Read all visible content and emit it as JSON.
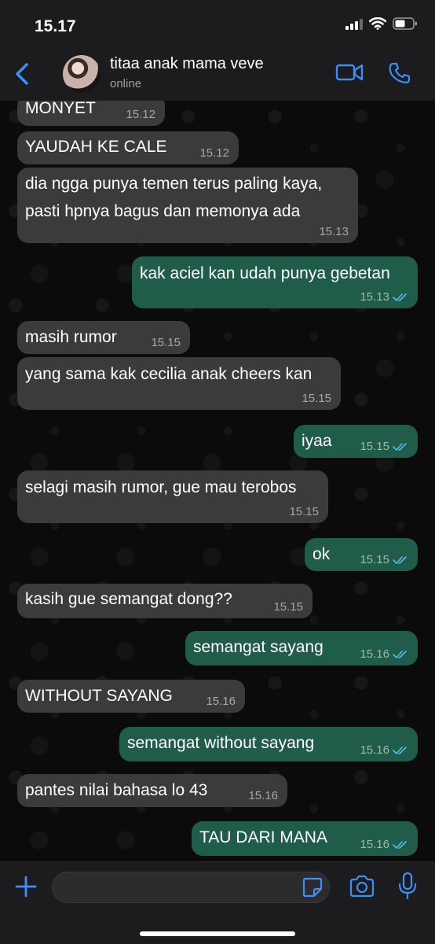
{
  "status_bar": {
    "time": "15.17"
  },
  "header": {
    "contact_name": "titaa anak mama veve",
    "status": "online"
  },
  "input": {
    "placeholder": ""
  },
  "messages": [
    {
      "dir": "in",
      "text": "MONYET",
      "time": "15.12"
    },
    {
      "dir": "in",
      "text": "YAUDAH KE CALE",
      "time": "15.12"
    },
    {
      "dir": "in",
      "text": "dia ngga punya temen terus paling kaya,\npasti hpnya bagus dan memonya ada",
      "time": "15.13"
    },
    {
      "dir": "out",
      "text": "kak aciel kan udah punya gebetan",
      "time": "15.13",
      "read": true
    },
    {
      "dir": "in",
      "text": "masih rumor",
      "time": "15.15"
    },
    {
      "dir": "in",
      "text": "yang sama kak cecilia anak cheers kan",
      "time": "15.15"
    },
    {
      "dir": "out",
      "text": "iyaa",
      "time": "15.15",
      "read": true
    },
    {
      "dir": "in",
      "text": "selagi masih rumor, gue mau terobos",
      "time": "15.15"
    },
    {
      "dir": "out",
      "text": "ok",
      "time": "15.15",
      "read": true
    },
    {
      "dir": "in",
      "text": "kasih gue semangat dong??",
      "time": "15.15"
    },
    {
      "dir": "out",
      "text": "semangat sayang",
      "time": "15.16",
      "read": true
    },
    {
      "dir": "in",
      "text": "WITHOUT SAYANG",
      "time": "15.16"
    },
    {
      "dir": "out",
      "text": "semangat without sayang",
      "time": "15.16",
      "read": true
    },
    {
      "dir": "in",
      "text": "pantes nilai bahasa lo 43",
      "time": "15.16"
    },
    {
      "dir": "out",
      "text": "TAU DARI MANA",
      "time": "15.16",
      "read": true
    }
  ],
  "colors": {
    "accent": "#3d8ff5",
    "incoming_bubble": "#3b3b3d",
    "outgoing_bubble": "#1f5c4a",
    "read_tick": "#53bdeb"
  },
  "icons": [
    "back-chevron-icon",
    "video-call-icon",
    "phone-call-icon",
    "plus-icon",
    "sticker-icon",
    "camera-icon",
    "microphone-icon",
    "read-receipt-icon"
  ]
}
